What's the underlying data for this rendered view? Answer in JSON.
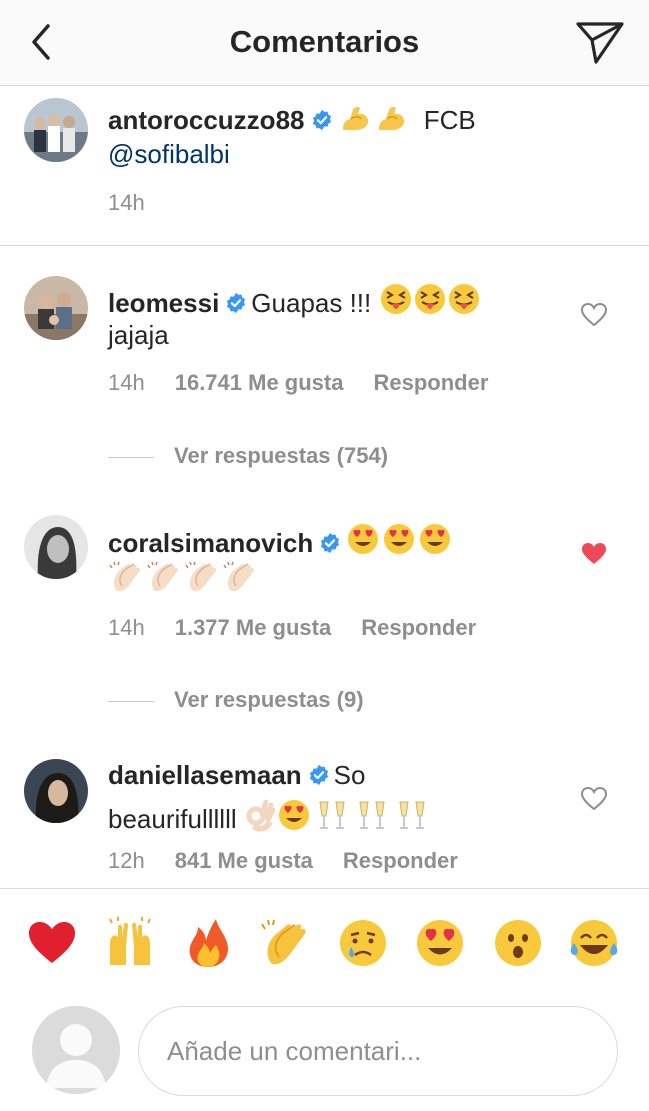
{
  "header": {
    "title": "Comentarios",
    "back_icon": "chevron-left-icon",
    "send_icon": "paper-plane-icon"
  },
  "caption": {
    "username": "antoroccuzzo88",
    "text_tail": "FCB",
    "mention": "@sofibalbi",
    "time": "14h"
  },
  "comments": [
    {
      "username": "leomessi",
      "text_line1": "Guapas !!!",
      "text_line2": "jajaja",
      "time": "14h",
      "likes": "16.741 Me gusta",
      "reply": "Responder",
      "liked": false,
      "view_replies": "Ver respuestas (754)"
    },
    {
      "username": "coralsimanovich",
      "time": "14h",
      "likes": "1.377 Me gusta",
      "reply": "Responder",
      "liked": true,
      "view_replies": "Ver respuestas (9)"
    },
    {
      "username": "daniellasemaan",
      "text_line1": "So",
      "text_line2": "beaurifullllll",
      "time": "12h",
      "likes": "841 Me gusta",
      "reply": "Responder",
      "liked": false
    }
  ],
  "quick_emojis": [
    "red-heart",
    "raising-hands",
    "fire",
    "clapping-hands",
    "crying-face",
    "heart-eyes",
    "surprised-face",
    "tears-of-joy"
  ],
  "composer": {
    "placeholder": "Añade un comentari..."
  },
  "colors": {
    "verified": "#3897f0",
    "liked_heart": "#ed4956",
    "muted_text": "#8e8e8e",
    "mention": "#003569"
  }
}
